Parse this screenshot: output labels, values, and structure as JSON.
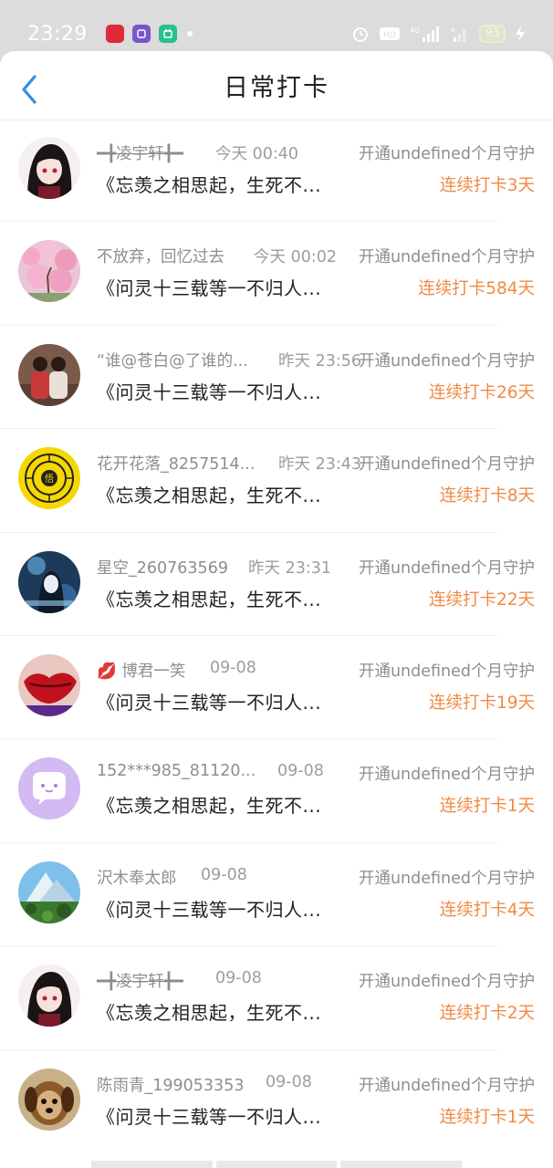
{
  "status_bar": {
    "time": "23:29",
    "battery": "93",
    "notification_icons": [
      {
        "name": "app-red-icon",
        "color": "#e02a3a",
        "label": "小红书"
      },
      {
        "name": "app-purple-icon",
        "color": "#7a56c9",
        "label": ""
      },
      {
        "name": "app-green-icon",
        "color": "#27c08a",
        "label": ""
      }
    ]
  },
  "header": {
    "title": "日常打卡",
    "back_icon": "chevron-left-icon",
    "accent": "#2f8fe6"
  },
  "colors": {
    "streak": "#f08a45",
    "meta_text": "#8e8e8e",
    "post_text": "#222222"
  },
  "items": [
    {
      "name": "━╋凌宇轩╋━",
      "time": "今天 00:40",
      "guard": "开通undefined个月守护",
      "post": "《忘羡之相思起，生死不...",
      "streak": "连续打卡3天",
      "avatar": "anime-girl-icon"
    },
    {
      "name": "不放弃，回忆过去",
      "time": "今天 00:02",
      "guard": "开通undefined个月守护",
      "post": "《问灵十三载等一不归人...",
      "streak": "连续打卡584天",
      "avatar": "pink-blossom-icon"
    },
    {
      "name": "“谁@苍白@了谁的...",
      "time": "昨天 23:56",
      "guard": "开通undefined个月守护",
      "post": "《问灵十三载等一不归人...",
      "streak": "连续打卡26天",
      "avatar": "photo-two-girls-icon"
    },
    {
      "name": "花开花落_8257514...",
      "time": "昨天 23:43",
      "guard": "开通undefined个月守护",
      "post": "《忘羡之相思起，生死不...",
      "streak": "连续打卡8天",
      "avatar": "bagua-yellow-icon"
    },
    {
      "name": "星空_260763569",
      "time": "昨天 23:31",
      "guard": "开通undefined个月守护",
      "post": "《忘羡之相思起，生死不...",
      "streak": "连续打卡22天",
      "avatar": "blue-anime-icon"
    },
    {
      "name": "博君一笑",
      "time": "09-08",
      "guard": "开通undefined个月守护",
      "post": "《问灵十三载等一不归人...",
      "streak": "连续打卡19天",
      "avatar": "red-lips-icon",
      "emoji": "💋"
    },
    {
      "name": "152***985_81120...",
      "time": "09-08",
      "guard": "开通undefined个月守护",
      "post": "《忘羡之相思起，生死不...",
      "streak": "连续打卡1天",
      "avatar": "default-chat-icon"
    },
    {
      "name": "沢木奉太郎",
      "time": "09-08",
      "guard": "开通undefined个月守护",
      "post": "《问灵十三载等一不归人...",
      "streak": "连续打卡4天",
      "avatar": "mountain-landscape-icon"
    },
    {
      "name": "━╋凌宇轩╋━",
      "time": "09-08",
      "guard": "开通undefined个月守护",
      "post": "《忘羡之相思起，生死不...",
      "streak": "连续打卡2天",
      "avatar": "anime-girl-icon"
    },
    {
      "name": "陈雨青_199053353",
      "time": "09-08",
      "guard": "开通undefined个月守护",
      "post": "《问灵十三载等一不归人...",
      "streak": "连续打卡1天",
      "avatar": "dog-photo-icon"
    }
  ]
}
